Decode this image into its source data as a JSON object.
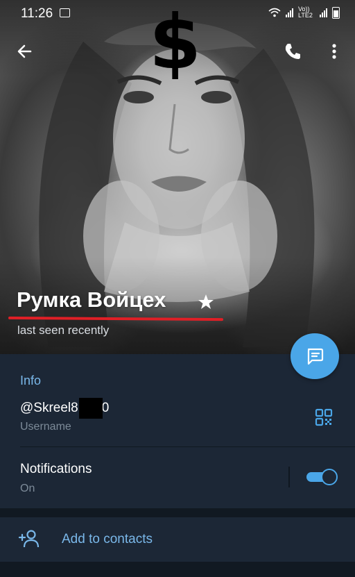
{
  "status_bar": {
    "time": "11:26",
    "network_label": "Vo)) LTE2"
  },
  "header": {
    "overlay_symbol": "$",
    "contact_name": "Румка Войцех",
    "last_seen": "last seen recently",
    "icons": [
      "arrow-left-icon",
      "phone-icon",
      "more-vertical-icon",
      "star-icon",
      "message-icon"
    ]
  },
  "info": {
    "section_title": "Info",
    "username_value": "@Skreel8",
    "username_suffix": "0",
    "username_label": "Username",
    "notifications_label": "Notifications",
    "notifications_value": "On",
    "notifications_enabled": true
  },
  "actions": {
    "add_to_contacts": "Add to contacts"
  },
  "colors": {
    "accent": "#4aa6e8",
    "link_text": "#7ab8ea",
    "background": "#1c2736",
    "underline": "#e01f26"
  }
}
